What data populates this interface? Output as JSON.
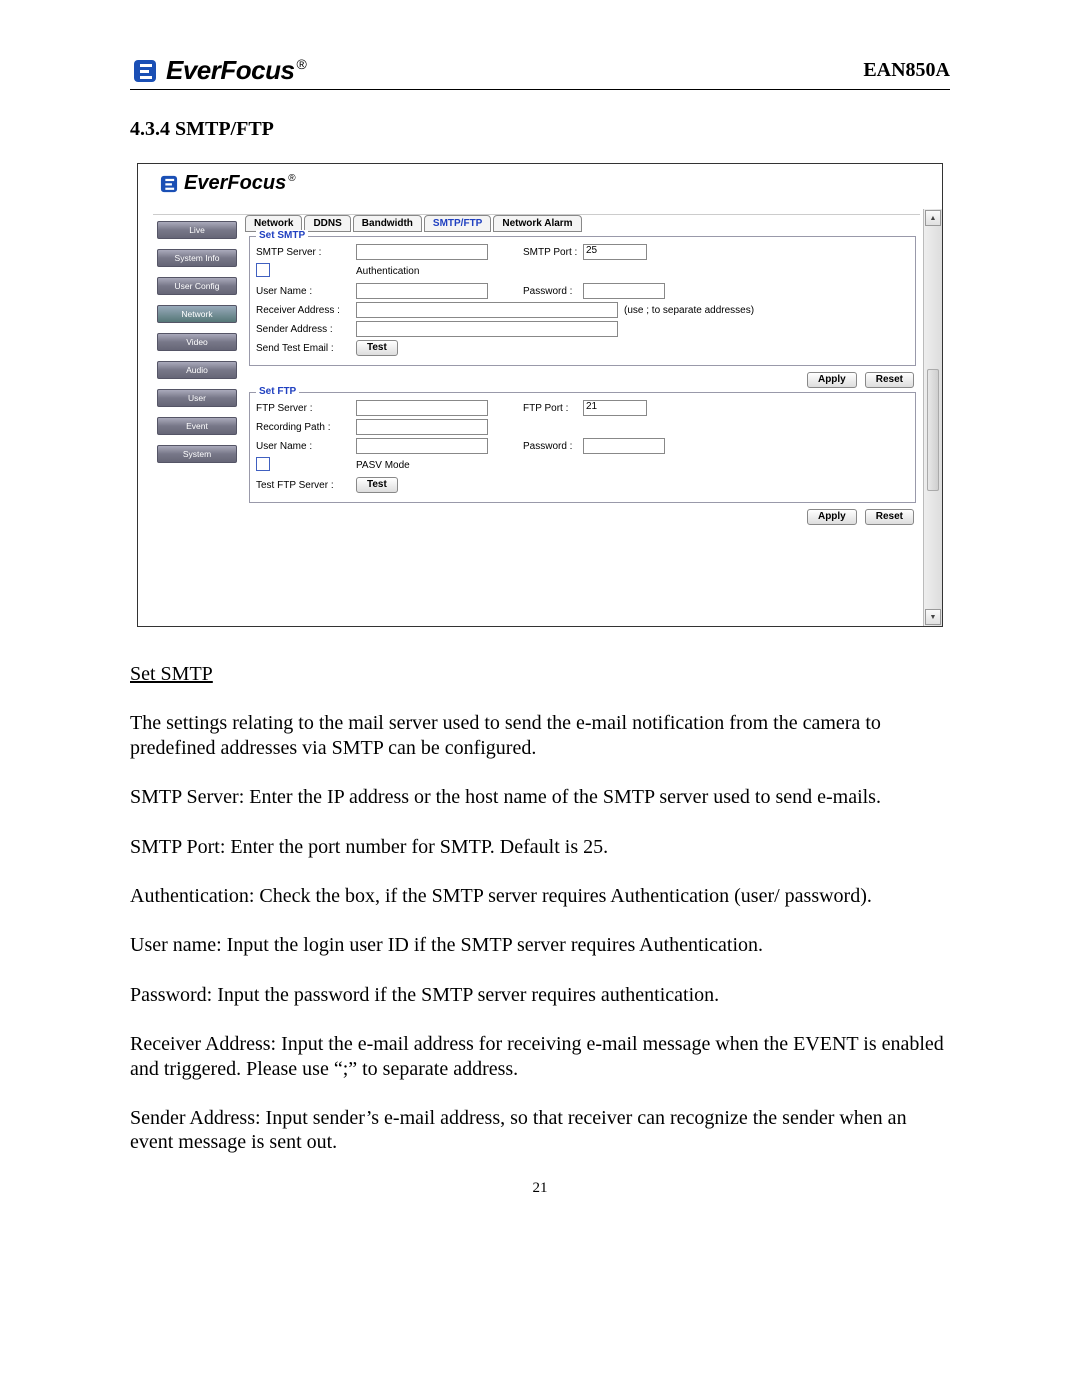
{
  "header": {
    "brand": "EverFocus",
    "model": "EAN850A"
  },
  "section_heading": "4.3.4 SMTP/FTP",
  "screenshot": {
    "brand": "EverFocus",
    "sidebar": {
      "items": [
        {
          "label": "Live"
        },
        {
          "label": "System Info"
        },
        {
          "label": "User Config"
        },
        {
          "label": "Network"
        },
        {
          "label": "Video"
        },
        {
          "label": "Audio"
        },
        {
          "label": "User"
        },
        {
          "label": "Event"
        },
        {
          "label": "System"
        }
      ]
    },
    "tabs": [
      {
        "label": "Network"
      },
      {
        "label": "DDNS"
      },
      {
        "label": "Bandwidth"
      },
      {
        "label": "SMTP/FTP"
      },
      {
        "label": "Network Alarm"
      }
    ],
    "smtp": {
      "legend": "Set SMTP",
      "server_label": "SMTP Server :",
      "port_label": "SMTP Port :",
      "port_value": "25",
      "auth_label": "Authentication",
      "user_label": "User Name :",
      "password_label": "Password :",
      "receiver_label": "Receiver Address :",
      "receiver_hint": "(use ; to separate addresses)",
      "sender_label": "Sender Address :",
      "sendtest_label": "Send Test Email :",
      "test_btn": "Test",
      "apply_btn": "Apply",
      "reset_btn": "Reset"
    },
    "ftp": {
      "legend": "Set FTP",
      "server_label": "FTP Server :",
      "port_label": "FTP Port :",
      "port_value": "21",
      "recpath_label": "Recording Path :",
      "user_label": "User Name :",
      "password_label": "Password :",
      "pasv_label": "PASV Mode",
      "test_label": "Test FTP Server :",
      "test_btn": "Test",
      "apply_btn": "Apply",
      "reset_btn": "Reset"
    }
  },
  "doc": {
    "subhead": "Set SMTP",
    "p1": "The settings relating to the mail server used to send the e-mail notification from the camera to predefined addresses via SMTP can be configured.",
    "p2": "SMTP Server: Enter the IP address or the host name of the SMTP server used to send e-mails.",
    "p3": "SMTP Port: Enter the port number for SMTP. Default is 25.",
    "p4": "Authentication: Check the box, if the SMTP server requires Authentication (user/ password).",
    "p5": "User name: Input the login user ID if the SMTP server requires Authentication.",
    "p6": "Password: Input the password if the SMTP server requires authentication.",
    "p7": "Receiver Address: Input the e-mail address for receiving e-mail message when the EVENT is enabled and triggered. Please use “;” to separate address.",
    "p8": "Sender Address: Input sender’s e-mail address, so that receiver can recognize the sender when an event message is sent out."
  },
  "page_number": "21"
}
